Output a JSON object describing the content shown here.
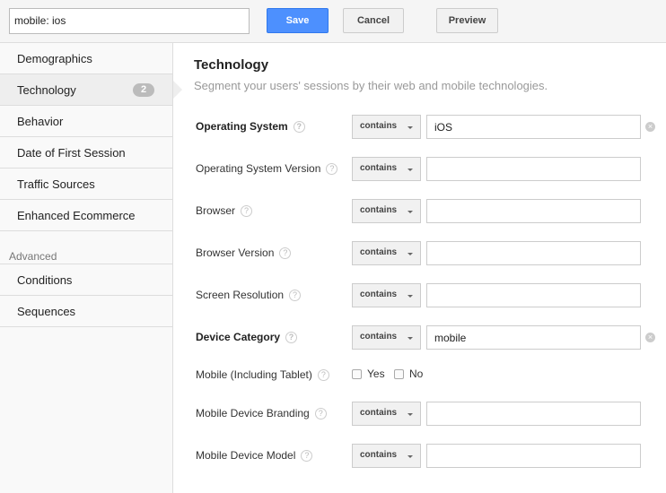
{
  "toolbar": {
    "segment_name": "mobile: ios",
    "save": "Save",
    "cancel": "Cancel",
    "preview": "Preview"
  },
  "sidebar": {
    "items": [
      {
        "label": "Demographics"
      },
      {
        "label": "Technology",
        "badge": "2"
      },
      {
        "label": "Behavior"
      },
      {
        "label": "Date of First Session"
      },
      {
        "label": "Traffic Sources"
      },
      {
        "label": "Enhanced Ecommerce"
      }
    ],
    "advanced_label": "Advanced",
    "advanced_items": [
      {
        "label": "Conditions"
      },
      {
        "label": "Sequences"
      }
    ]
  },
  "main": {
    "title": "Technology",
    "subtitle": "Segment your users' sessions by their web and mobile technologies.",
    "rows": [
      {
        "label": "Operating System",
        "operator": "contains",
        "value": "iOS"
      },
      {
        "label": "Operating System Version",
        "operator": "contains",
        "value": ""
      },
      {
        "label": "Browser",
        "operator": "contains",
        "value": ""
      },
      {
        "label": "Browser Version",
        "operator": "contains",
        "value": ""
      },
      {
        "label": "Screen Resolution",
        "operator": "contains",
        "value": ""
      },
      {
        "label": "Device Category",
        "operator": "contains",
        "value": "mobile"
      },
      {
        "label": "Mobile (Including Tablet)",
        "yes": "Yes",
        "no": "No"
      },
      {
        "label": "Mobile Device Branding",
        "operator": "contains",
        "value": ""
      },
      {
        "label": "Mobile Device Model",
        "operator": "contains",
        "value": ""
      }
    ]
  },
  "colors": {
    "save": "#4d90fe"
  },
  "help_glyph": "?"
}
